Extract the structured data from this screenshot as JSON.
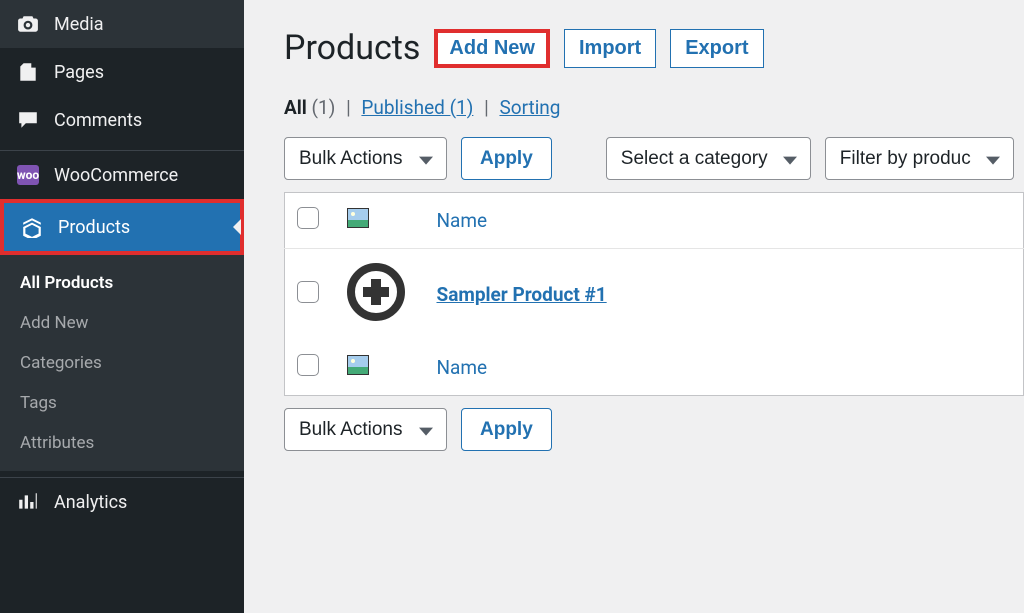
{
  "sidebar": {
    "media": "Media",
    "pages": "Pages",
    "comments": "Comments",
    "woocommerce": "WooCommerce",
    "products": "Products",
    "analytics": "Analytics",
    "submenu": {
      "all_products": "All Products",
      "add_new": "Add New",
      "categories": "Categories",
      "tags": "Tags",
      "attributes": "Attributes"
    }
  },
  "header": {
    "title": "Products",
    "add_new": "Add New",
    "import": "Import",
    "export": "Export"
  },
  "filters": {
    "all_label": "All",
    "all_count": "(1)",
    "published_label": "Published (1)",
    "sorting_label": "Sorting"
  },
  "actions": {
    "bulk": "Bulk Actions",
    "apply": "Apply",
    "select_category": "Select a category",
    "filter_product": "Filter by produc"
  },
  "table": {
    "name_header": "Name",
    "product1_name": "Sampler Product #1"
  }
}
